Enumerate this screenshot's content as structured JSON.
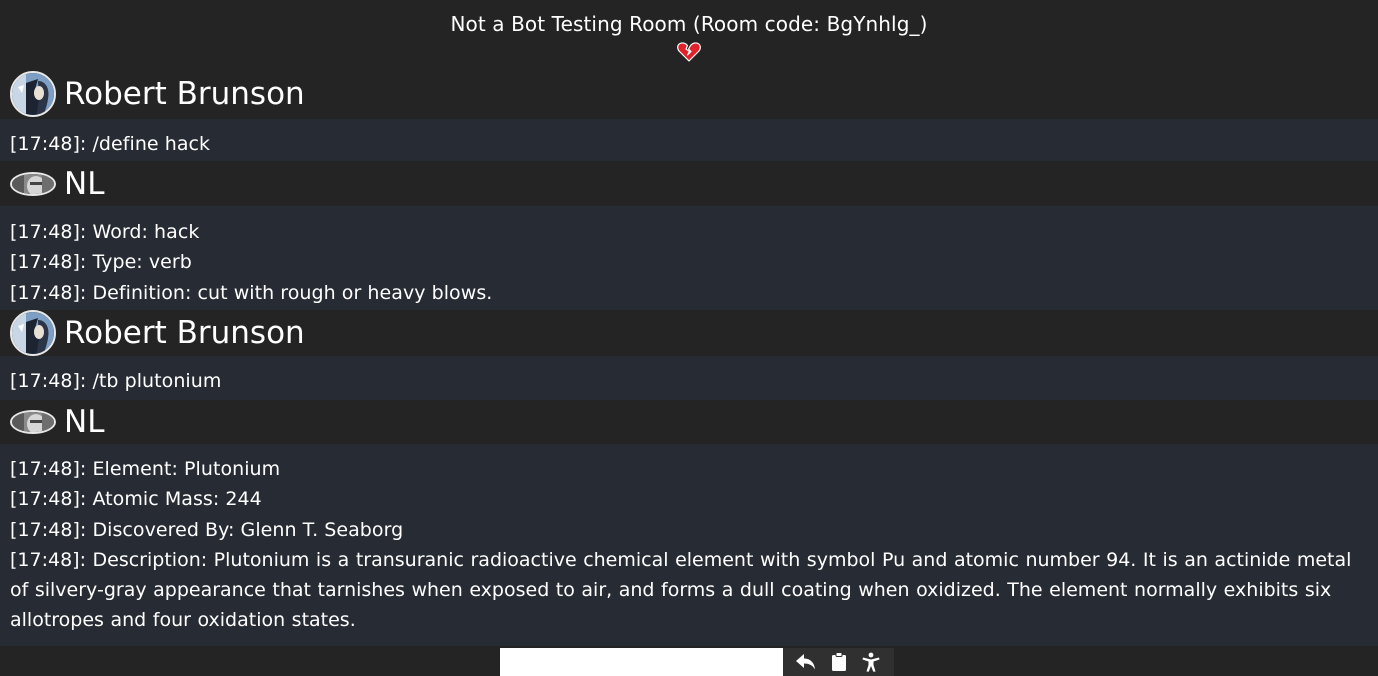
{
  "room": {
    "title": "Not a Bot Testing Room (Room code: BgYnhlg_)",
    "status_icon": "broken-heart-icon",
    "status_color": "#e0222a"
  },
  "messages": [
    {
      "user": "Robert Brunson",
      "avatar_shape": "round",
      "lines": [
        "[17:48]: /define hack"
      ]
    },
    {
      "user": "NL",
      "avatar_shape": "oval",
      "lines": [
        "[17:48]: Word: hack",
        "[17:48]: Type: verb",
        "[17:48]: Definition: cut with rough or heavy blows."
      ]
    },
    {
      "user": "Robert Brunson",
      "avatar_shape": "round",
      "lines": [
        "[17:48]: /tb plutonium"
      ]
    },
    {
      "user": "NL",
      "avatar_shape": "oval",
      "lines": [
        "[17:48]: Element: Plutonium",
        "[17:48]: Atomic Mass: 244",
        "[17:48]: Discovered By: Glenn T. Seaborg",
        "[17:48]: Description: Plutonium is a transuranic radioactive chemical element with symbol Pu and atomic number 94. It is an actinide metal of silvery-gray appearance that tarnishes when exposed to air, and forms a dull coating when oxidized. The element normally exhibits six allotropes and four oxidation states."
      ]
    }
  ],
  "input": {
    "value": "",
    "placeholder": ""
  },
  "toolbar": {
    "buttons": [
      "reply-icon",
      "clipboard-icon",
      "accessibility-icon"
    ]
  },
  "colors": {
    "background": "#242424",
    "message_block": "#272b33",
    "text": "#ffffff",
    "toolbar_bg": "#303030"
  }
}
